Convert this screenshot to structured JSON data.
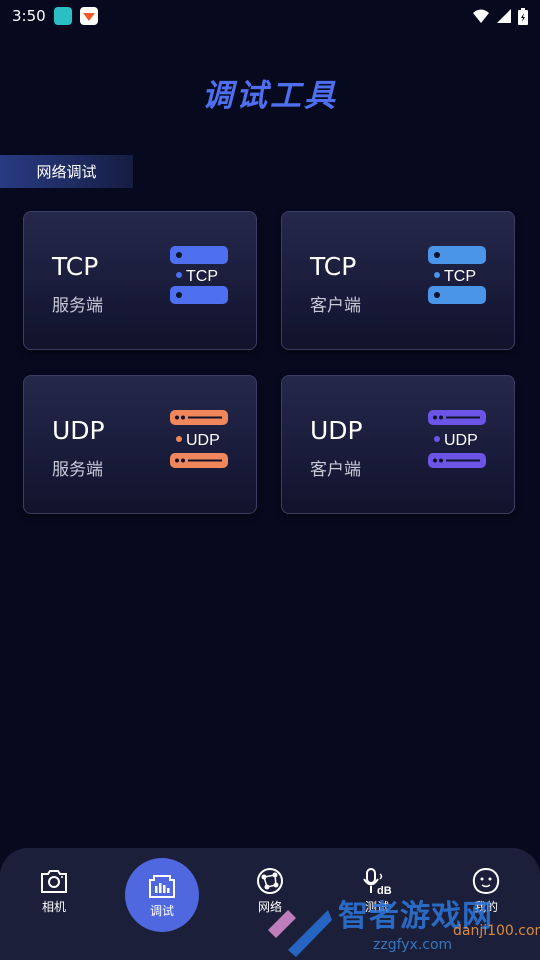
{
  "status_bar": {
    "time": "3:50"
  },
  "title": "调试工具",
  "section": "网络调试",
  "cards": [
    {
      "protocol": "TCP",
      "role": "服务端",
      "icon_label": "TCP",
      "color": "#4e6ff0"
    },
    {
      "protocol": "TCP",
      "role": "客户端",
      "icon_label": "TCP",
      "color": "#4a95e8"
    },
    {
      "protocol": "UDP",
      "role": "服务端",
      "icon_label": "UDP",
      "color": "#f0875c"
    },
    {
      "protocol": "UDP",
      "role": "客户端",
      "icon_label": "UDP",
      "color": "#6b54e6"
    }
  ],
  "nav": [
    {
      "label": "相机",
      "icon": "camera-icon"
    },
    {
      "label": "调试",
      "icon": "debug-icon",
      "active": true
    },
    {
      "label": "网络",
      "icon": "network-icon"
    },
    {
      "label": "测试",
      "icon": "decibel-icon"
    },
    {
      "label": "我的",
      "icon": "profile-icon"
    }
  ],
  "watermark": {
    "text": "智者游戏网",
    "url": "zzgfyx.com",
    "url2": "danji100.com"
  },
  "colors": {
    "accent": "#4f68e0",
    "background": "#070a1f"
  }
}
